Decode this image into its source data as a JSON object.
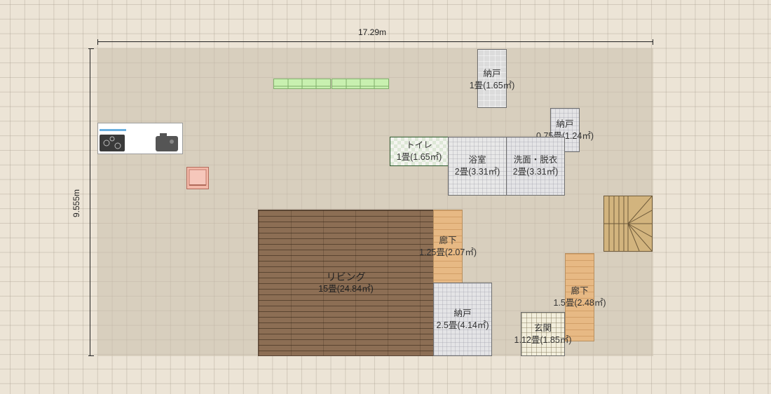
{
  "dimensions": {
    "width_label": "17.29m",
    "height_label": "9.555m"
  },
  "rooms": {
    "storage_top": {
      "name": "納戸",
      "area": "1畳(1.65㎡)"
    },
    "storage_small": {
      "name": "納戸",
      "area": "0.75畳(1.24㎡)"
    },
    "toilet": {
      "name": "トイレ",
      "area": "1畳(1.65㎡)"
    },
    "bathroom": {
      "name": "浴室",
      "area": "2畳(3.31㎡)"
    },
    "washroom": {
      "name": "洗面・脱衣",
      "area": "2畳(3.31㎡)"
    },
    "hallway_center": {
      "name": "廊下",
      "area": "1.25畳(2.07㎡)"
    },
    "living": {
      "name": "リビング",
      "area": "15畳(24.84㎡)"
    },
    "storage_bottom": {
      "name": "納戸",
      "area": "2.5畳(4.14㎡)"
    },
    "hallway_right": {
      "name": "廊下",
      "area": "1.5畳(2.48㎡)"
    },
    "entrance": {
      "name": "玄関",
      "area": "1.12畳(1.85㎡)"
    }
  },
  "colors": {
    "background": "#ece4d6",
    "plot": "#cbc1ae",
    "living_floor": "#8c6e54",
    "hallway_floor": "#e7b984",
    "bench": "#c8f0b0"
  },
  "icons": [
    "kitchen-stove-icon",
    "sink-icon",
    "small-table-icon",
    "staircase-icon",
    "bench-icon"
  ]
}
